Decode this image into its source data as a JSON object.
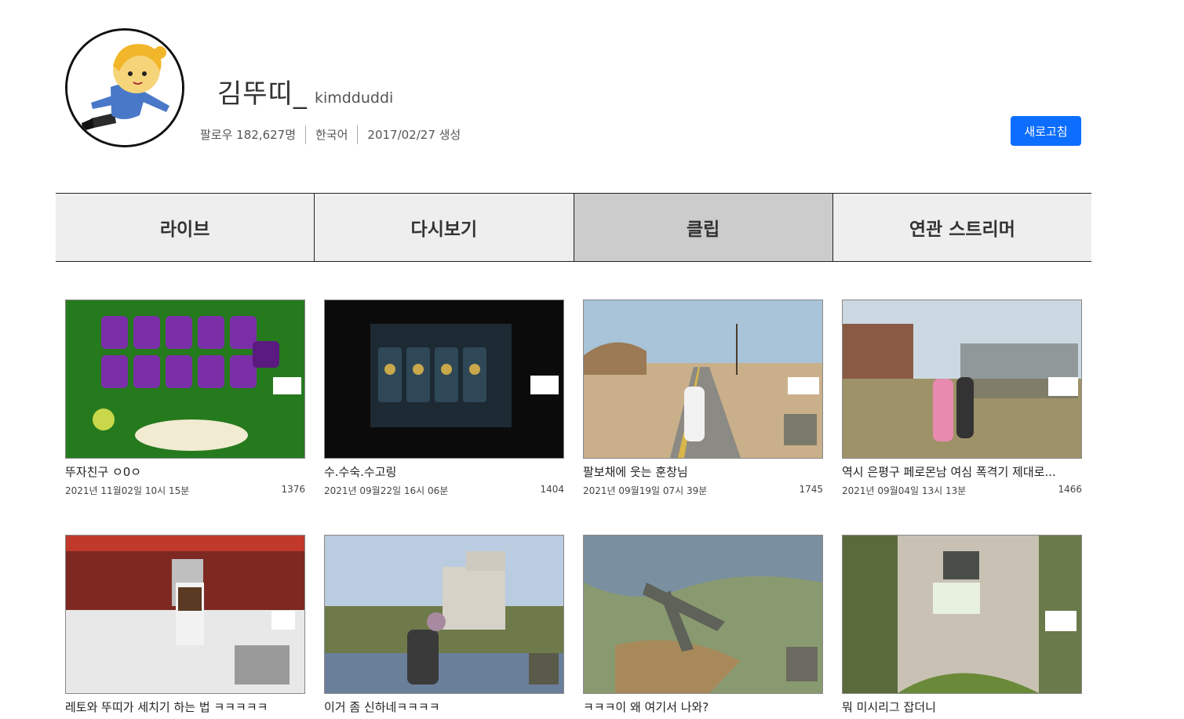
{
  "profile": {
    "display_name": "김뚜띠_",
    "login_id": "kimdduddi",
    "followers": "팔로우 182,627명",
    "language": "한국어",
    "created": "2017/02/27 생성",
    "refresh_label": "새로고침"
  },
  "tabs": [
    {
      "label": "라이브",
      "active": false
    },
    {
      "label": "다시보기",
      "active": false
    },
    {
      "label": "클립",
      "active": true
    },
    {
      "label": "연관 스트리머",
      "active": false
    }
  ],
  "clips": [
    {
      "title": "뚜자친구 ㅇ0ㅇ",
      "date": "2021년 11월02일 10시 15분",
      "views": "1376"
    },
    {
      "title": "수.수숙.수고링",
      "date": "2021년 09월22일 16시 06분",
      "views": "1404"
    },
    {
      "title": "팔보채에 웃는 훈창님",
      "date": "2021년 09월19일 07시 39분",
      "views": "1745"
    },
    {
      "title": "역시 은평구 페로몬남 여심 폭격기 제대로...",
      "date": "2021년 09월04일 13시 13분",
      "views": "1466"
    },
    {
      "title": "레토와 뚜띠가 세치기 하는 법 ㅋㅋㅋㅋㅋ",
      "date": "",
      "views": ""
    },
    {
      "title": "이거 좀 신하네ㅋㅋㅋㅋ",
      "date": "",
      "views": ""
    },
    {
      "title": "ㅋㅋㅋ이 왜 여기서 나와?",
      "date": "",
      "views": ""
    },
    {
      "title": "뭐 미시리그 잡더니",
      "date": "",
      "views": ""
    }
  ]
}
